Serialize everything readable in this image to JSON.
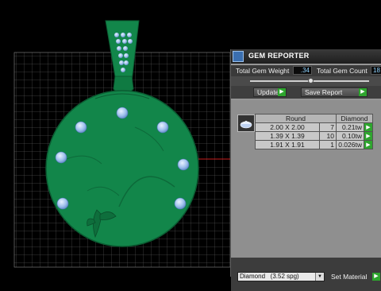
{
  "viewport": {
    "name": "3d-viewport",
    "model": "green pendant with gem settings",
    "colors": {
      "background": "#000000",
      "grid": "#7a7a7a",
      "model": "#12864a",
      "gems": "#a8c8f0",
      "axis": "#ff2020"
    }
  },
  "panel": {
    "title": "GEM REPORTER",
    "total_gem_weight_label": "Total Gem Weight",
    "total_gem_weight_value": ".34",
    "total_gem_count_label": "Total Gem Count",
    "total_gem_count_value": "18",
    "update_label": "Update",
    "save_report_label": "Save Report",
    "table": {
      "headers": [
        "Round",
        "Diamond"
      ],
      "rows": [
        {
          "size": "2.00 X 2.00",
          "count": "7",
          "weight": "0.21tw"
        },
        {
          "size": "1.39 X 1.39",
          "count": "10",
          "weight": "0.10tw"
        },
        {
          "size": "1.91 X 1.91",
          "count": "1",
          "weight": "0.026tw"
        }
      ]
    },
    "material_selected": "Diamond   (3.52 spg)",
    "set_material_label": "Set Material",
    "accent_color": "#2ea52e"
  }
}
